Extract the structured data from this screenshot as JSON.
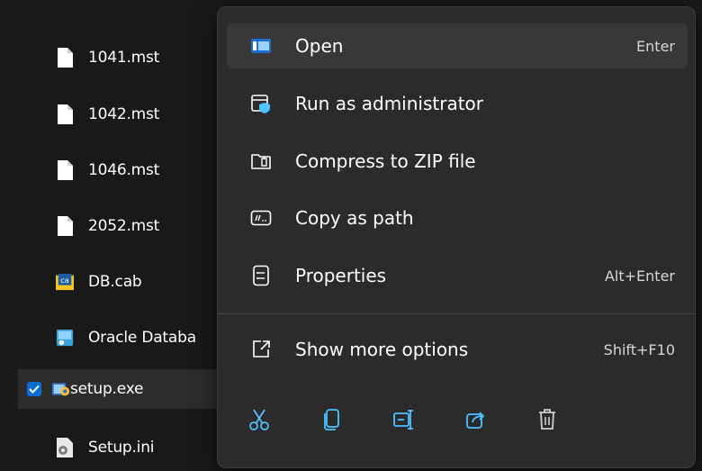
{
  "files": [
    {
      "name": "1041.mst",
      "icon": "document-icon"
    },
    {
      "name": "1042.mst",
      "icon": "document-icon"
    },
    {
      "name": "1046.mst",
      "icon": "document-icon"
    },
    {
      "name": "2052.mst",
      "icon": "document-icon"
    },
    {
      "name": "DB.cab",
      "icon": "cabinet-icon"
    },
    {
      "name": "Oracle Databa",
      "icon": "installer-icon"
    },
    {
      "name": "setup.exe",
      "icon": "setup-icon",
      "selected": true
    },
    {
      "name": "Setup.ini",
      "icon": "settings-file-icon"
    }
  ],
  "context_menu": {
    "items": [
      {
        "label": "Open",
        "shortcut": "Enter",
        "icon": "open-icon"
      },
      {
        "label": "Run as administrator",
        "shortcut": "",
        "icon": "shield-window-icon"
      },
      {
        "label": "Compress to ZIP file",
        "shortcut": "",
        "icon": "zip-folder-icon"
      },
      {
        "label": "Copy as path",
        "shortcut": "",
        "icon": "copy-path-icon"
      },
      {
        "label": "Properties",
        "shortcut": "Alt+Enter",
        "icon": "properties-icon"
      },
      {
        "label": "Show more options",
        "shortcut": "Shift+F10",
        "icon": "more-options-icon"
      }
    ],
    "actions": [
      "cut-icon",
      "copy-icon",
      "rename-icon",
      "share-icon",
      "delete-icon"
    ]
  },
  "colors": {
    "accent": "#4cc2ff",
    "checkbox": "#0a6ed1",
    "menu_bg": "#2b2b2b",
    "hover_bg": "#383838"
  }
}
